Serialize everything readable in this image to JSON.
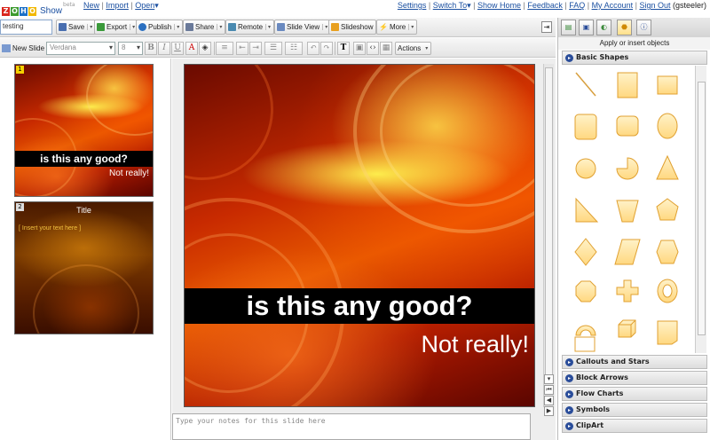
{
  "app": {
    "logo_letters": [
      "Z",
      "O",
      "H",
      "O"
    ],
    "name": "Show",
    "beta": "beta"
  },
  "top_menu": {
    "new": "New",
    "import": "Import",
    "open": "Open"
  },
  "top_links": {
    "settings": "Settings",
    "switch_to": "Switch To",
    "show_home": "Show Home",
    "feedback": "Feedback",
    "faq": "FAQ",
    "my_account": "My Account",
    "sign_out": "Sign Out",
    "user": "(gsteeler)"
  },
  "toolbar": {
    "presentation_name": "testing",
    "save": "Save",
    "export": "Export",
    "publish": "Publish",
    "share": "Share",
    "remote": "Remote",
    "slide_view": "Slide View",
    "slideshow": "Slideshow",
    "more": "More"
  },
  "format_bar": {
    "new_slide": "New Slide",
    "font": "Verdana",
    "size": "8",
    "bold": "B",
    "italic": "I",
    "underline": "U",
    "text_tool": "T",
    "actions": "Actions"
  },
  "slides": [
    {
      "number": "1",
      "title": "is this any good?",
      "subtitle": "Not really!"
    },
    {
      "number": "2",
      "title": "Title",
      "placeholder": "[ Insert your text here ]"
    }
  ],
  "current_slide": {
    "title": "is this any good?",
    "subtitle": "Not really!"
  },
  "notes": {
    "placeholder": "Type your notes for this slide here"
  },
  "right_panel": {
    "caption": "Apply or insert objects",
    "categories": {
      "basic_shapes": "Basic Shapes",
      "callouts": "Callouts and Stars",
      "block_arrows": "Block Arrows",
      "flow_charts": "Flow Charts",
      "symbols": "Symbols",
      "clipart": "ClipArt"
    }
  },
  "colors": {
    "link": "#1a4fa0",
    "shape_fill": "#ffe29a",
    "shape_stroke": "#e0a030",
    "category_bullet": "#2a4d9a"
  }
}
